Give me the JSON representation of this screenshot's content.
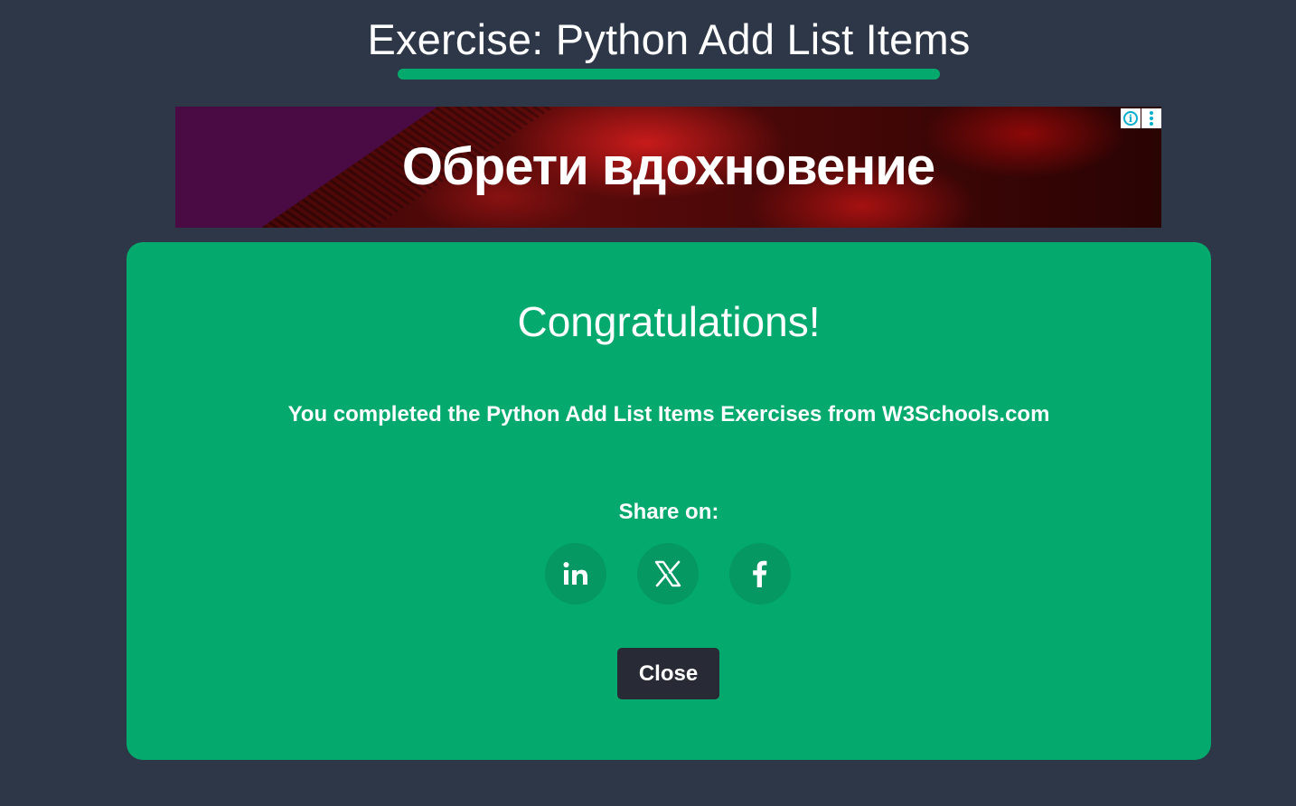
{
  "page": {
    "title": "Exercise: Python Add List Items"
  },
  "ad": {
    "headline": "Обрети вдохновение",
    "choices_info_icon": "info-icon",
    "choices_menu_icon": "more-vertical-icon"
  },
  "modal": {
    "heading": "Congratulations!",
    "message": "You completed the Python Add List Items Exercises from W3Schools.com",
    "share_label": "Share on:",
    "share_buttons": [
      {
        "icon": "linkedin-icon"
      },
      {
        "icon": "x-twitter-icon"
      },
      {
        "icon": "facebook-icon"
      }
    ],
    "close_label": "Close"
  },
  "colors": {
    "background": "#2d3748",
    "accent": "#04aa6d",
    "share_button": "#059862",
    "close_button": "#282a35"
  }
}
